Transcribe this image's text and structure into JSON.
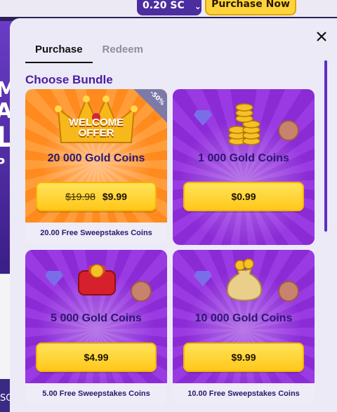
{
  "background": {
    "sc_balance": "0.20 SC",
    "purchase_now_label": "Purchase Now",
    "left_letters": [
      "M",
      "A",
      "L",
      "P"
    ],
    "bottom_left_text": "SO"
  },
  "modal": {
    "tabs": [
      {
        "label": "Purchase",
        "active": true
      },
      {
        "label": "Redeem",
        "active": false
      }
    ],
    "section_title": "Choose Bundle",
    "colors": {
      "accent_purple": "#4b1ea0",
      "button_yellow": "#ffc81a"
    },
    "bundles": [
      {
        "title": "20 000 Gold Coins",
        "old_price": "$19.98",
        "price": "$9.99",
        "footer": "20.00 Free Sweepstakes Coins",
        "badge": "-50%",
        "banner": "WELCOME OFFER",
        "theme": "orange",
        "icon": "crown-icon"
      },
      {
        "title": "1 000 Gold Coins",
        "price": "$0.99",
        "footer": "",
        "theme": "purple",
        "icon": "coin-stack-icon"
      },
      {
        "title": "5 000 Gold Coins",
        "price": "$4.99",
        "footer": "5.00 Free Sweepstakes Coins",
        "theme": "purple",
        "icon": "coin-wallet-icon"
      },
      {
        "title": "10 000 Gold Coins",
        "price": "$9.99",
        "footer": "10.00 Free Sweepstakes Coins",
        "theme": "purple",
        "icon": "coin-bag-icon"
      }
    ]
  }
}
